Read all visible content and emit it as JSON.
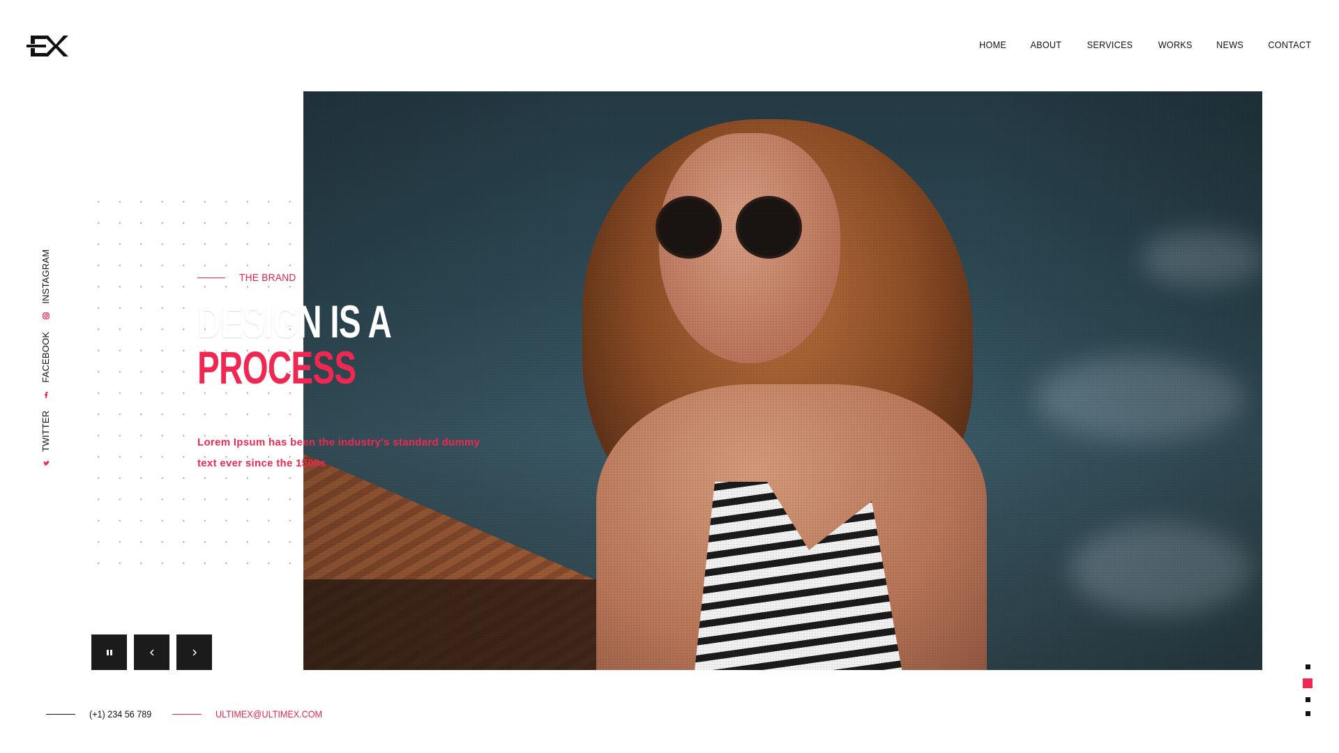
{
  "logo": {
    "text": "EX"
  },
  "nav": {
    "items": [
      "HOME",
      "ABOUT",
      "SERVICES",
      "WORKS",
      "NEWS",
      "CONTACT"
    ]
  },
  "social": {
    "items": [
      {
        "label": "TWITTER",
        "icon": "twitter-icon"
      },
      {
        "label": "FACEBOOK",
        "icon": "facebook-icon"
      },
      {
        "label": "INSTAGRAM",
        "icon": "instagram-icon"
      }
    ]
  },
  "hero": {
    "tag": "THE BRAND",
    "headline_line1": "DESIGN IS A",
    "headline_line2": "PROCESS",
    "description": "Lorem Ipsum has been the industry's standard dummy text ever since the 1500s"
  },
  "controls": {
    "pause_icon": "pause-icon",
    "prev_icon": "chevron-left-icon",
    "next_icon": "chevron-right-icon"
  },
  "contact": {
    "phone": "(+1) 234 56 789",
    "email": "ULTIMEX@ULTIMEX.COM"
  },
  "pagination": {
    "count": 4,
    "active_index": 1
  },
  "colors": {
    "accent": "#ef2751",
    "dark": "#1b1b1b",
    "background": "#ffffff"
  }
}
